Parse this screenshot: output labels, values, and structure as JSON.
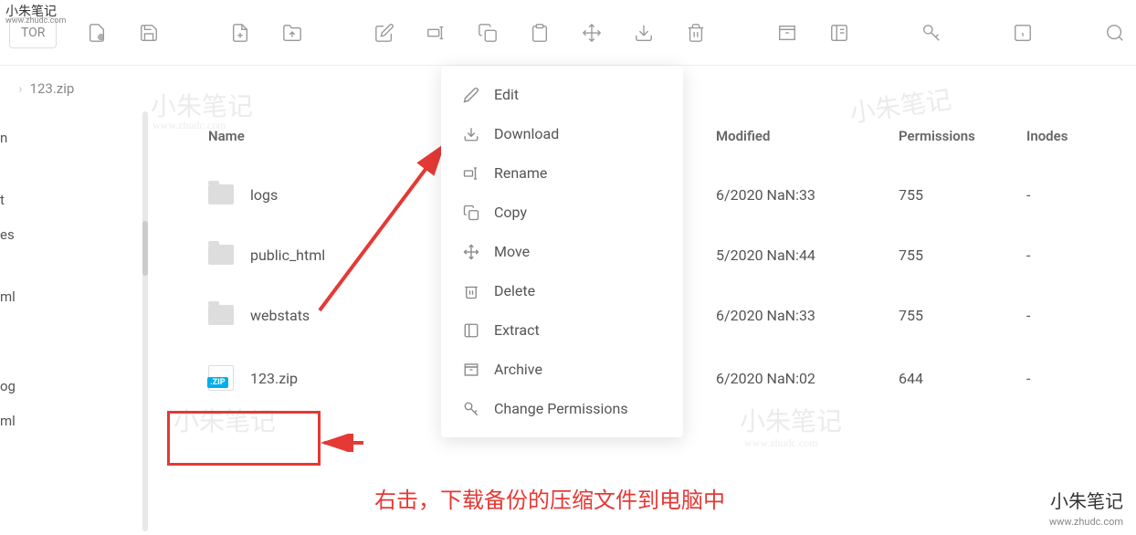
{
  "toolbar": {
    "tor_label": "TOR"
  },
  "breadcrumb": {
    "current": "123.zip"
  },
  "sidebar": {
    "items": [
      {
        "label": "n"
      },
      {
        "label": "t"
      },
      {
        "label": "es"
      },
      {
        "label": "ml"
      },
      {
        "label": "og"
      },
      {
        "label": "ml"
      }
    ]
  },
  "table": {
    "headers": {
      "name": "Name",
      "modified": "Modified",
      "permissions": "Permissions",
      "inodes": "Inodes"
    },
    "rows": [
      {
        "name": "logs",
        "type": "folder",
        "modified": "6/2020 NaN:33",
        "permissions": "755",
        "inodes": "-"
      },
      {
        "name": "public_html",
        "type": "folder",
        "modified": "5/2020 NaN:44",
        "permissions": "755",
        "inodes": "-"
      },
      {
        "name": "webstats",
        "type": "folder",
        "modified": "6/2020 NaN:33",
        "permissions": "755",
        "inodes": "-"
      },
      {
        "name": "123.zip",
        "type": "zip",
        "modified": "6/2020 NaN:02",
        "permissions": "644",
        "inodes": "-"
      }
    ]
  },
  "context_menu": {
    "items": [
      {
        "label": "Edit",
        "icon": "pencil"
      },
      {
        "label": "Download",
        "icon": "download"
      },
      {
        "label": "Rename",
        "icon": "rename"
      },
      {
        "label": "Copy",
        "icon": "copy"
      },
      {
        "label": "Move",
        "icon": "move"
      },
      {
        "label": "Delete",
        "icon": "trash"
      },
      {
        "label": "Extract",
        "icon": "extract"
      },
      {
        "label": "Archive",
        "icon": "archive"
      },
      {
        "label": "Change Permissions",
        "icon": "key"
      }
    ]
  },
  "annotation": {
    "text": "右击，下载备份的压缩文件到电脑中"
  },
  "watermark": {
    "brand": "小朱笔记",
    "url": "www.zhudc.com"
  },
  "zip_badge": ".ZIP"
}
